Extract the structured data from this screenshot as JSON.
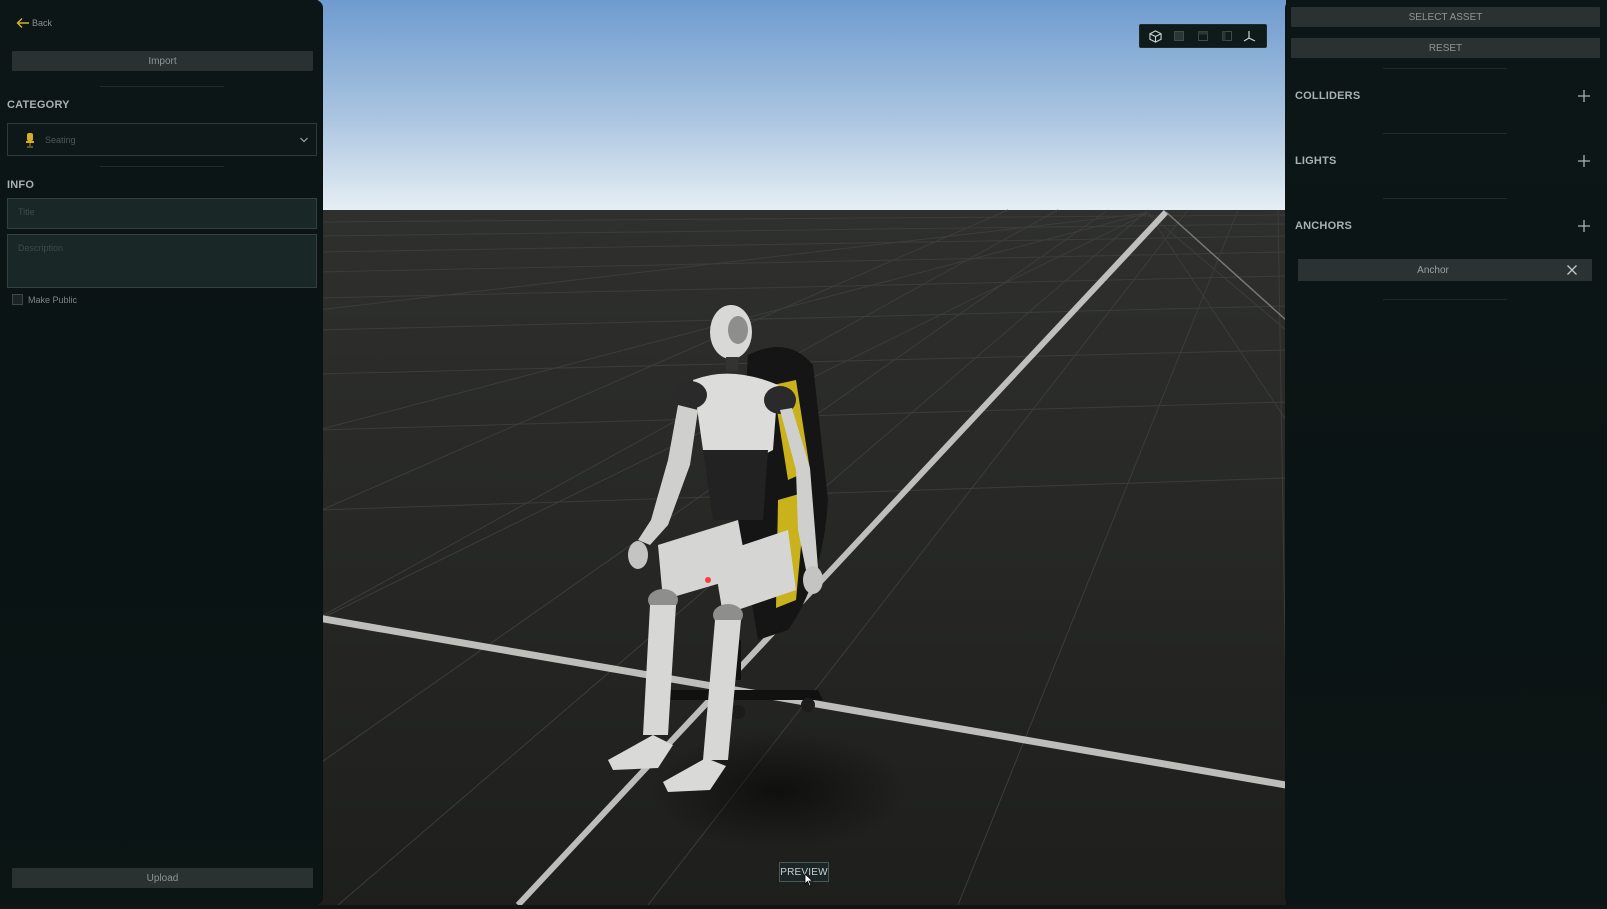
{
  "left_panel": {
    "back_label": "Back",
    "import_label": "Import",
    "category_title": "CATEGORY",
    "category_selected": "Seating",
    "info_title": "INFO",
    "title_placeholder": "Title",
    "description_placeholder": "Description",
    "make_public_label": "Make Public",
    "make_public_checked": false,
    "upload_label": "Upload"
  },
  "right_panel": {
    "select_asset_label": "SELECT ASSET",
    "reset_label": "RESET",
    "sections": [
      {
        "title": "COLLIDERS",
        "items": []
      },
      {
        "title": "LIGHTS",
        "items": []
      },
      {
        "title": "ANCHORS",
        "items": [
          "Anchor"
        ]
      }
    ]
  },
  "viewport": {
    "preview_label": "PREVIEW",
    "toolbar_icons": [
      "cube-icon",
      "front-view-icon",
      "top-view-icon",
      "side-view-icon",
      "axes-icon"
    ]
  },
  "colors": {
    "accent": "#d4b02a",
    "panel_bg": "#0d1616",
    "button_bg": "#2a3131"
  }
}
